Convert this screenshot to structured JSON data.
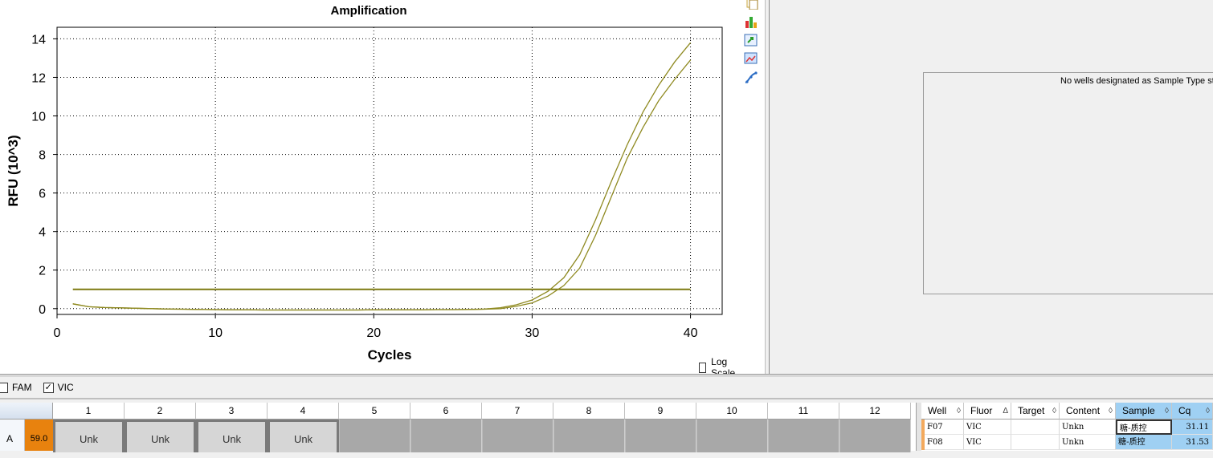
{
  "chart": {
    "title": "Amplification",
    "xlabel": "Cycles",
    "ylabel": "RFU (10^3)",
    "log_scale_label": "Log Scale",
    "log_scale_checked": false
  },
  "chart_data": {
    "type": "line",
    "title": "Amplification",
    "xlabel": "Cycles",
    "ylabel": "RFU (10^3)",
    "xlim": [
      0,
      42
    ],
    "ylim": [
      -0.3,
      14.6
    ],
    "xticks": [
      0,
      10,
      20,
      30,
      40
    ],
    "yticks": [
      0,
      2,
      4,
      6,
      8,
      10,
      12,
      14
    ],
    "grid": true,
    "line_color": "#8f8a21",
    "threshold": 1.0,
    "threshold_x": [
      1,
      40
    ],
    "x": [
      1,
      2,
      3,
      4,
      5,
      6,
      7,
      8,
      9,
      10,
      11,
      12,
      13,
      14,
      15,
      16,
      17,
      18,
      19,
      20,
      21,
      22,
      23,
      24,
      25,
      26,
      27,
      28,
      29,
      30,
      31,
      32,
      33,
      34,
      35,
      36,
      37,
      38,
      39,
      40
    ],
    "series": [
      {
        "values": [
          0.25,
          0.1,
          0.06,
          0.04,
          0.02,
          0.0,
          -0.02,
          -0.03,
          -0.04,
          -0.05,
          -0.06,
          -0.06,
          -0.07,
          -0.07,
          -0.07,
          -0.07,
          -0.07,
          -0.07,
          -0.07,
          -0.06,
          -0.06,
          -0.06,
          -0.06,
          -0.05,
          -0.05,
          -0.04,
          -0.02,
          0.05,
          0.2,
          0.45,
          0.9,
          1.6,
          2.8,
          4.6,
          6.6,
          8.5,
          10.2,
          11.6,
          12.8,
          13.8
        ]
      },
      {
        "values": [
          0.25,
          0.1,
          0.06,
          0.04,
          0.02,
          0.0,
          -0.02,
          -0.03,
          -0.04,
          -0.05,
          -0.06,
          -0.06,
          -0.07,
          -0.07,
          -0.07,
          -0.07,
          -0.07,
          -0.07,
          -0.07,
          -0.06,
          -0.06,
          -0.06,
          -0.06,
          -0.05,
          -0.05,
          -0.04,
          -0.03,
          0.0,
          0.12,
          0.3,
          0.65,
          1.2,
          2.1,
          3.8,
          5.8,
          7.8,
          9.4,
          10.8,
          11.9,
          12.9
        ]
      }
    ]
  },
  "tools": [
    "copy-icon",
    "bar-chart-icon",
    "export-icon",
    "image-icon",
    "curve-icon"
  ],
  "standard_curve": {
    "message": "No wells designated as Sample Type sta"
  },
  "fluors": [
    {
      "label": "FAM",
      "checked": false
    },
    {
      "label": "VIC",
      "checked": true
    }
  ],
  "plate": {
    "columns": [
      "1",
      "2",
      "3",
      "4",
      "5",
      "6",
      "7",
      "8",
      "9",
      "10",
      "11",
      "12"
    ],
    "row_label": "A",
    "temperature": "59.0",
    "wells": [
      "Unk",
      "Unk",
      "Unk",
      "Unk",
      "",
      "",
      "",
      "",
      "",
      "",
      "",
      ""
    ]
  },
  "well_table": {
    "headers": [
      {
        "label": "Well",
        "sort": "◊"
      },
      {
        "label": "Fluor",
        "sort": "Δ"
      },
      {
        "label": "Target",
        "sort": "◊"
      },
      {
        "label": "Content",
        "sort": "◊"
      },
      {
        "label": "Sample",
        "sort": "◊"
      },
      {
        "label": "Cq",
        "sort": "◊"
      }
    ],
    "rows": [
      {
        "well": "F07",
        "fluor": "VIC",
        "target": "",
        "content": "Unkn",
        "sample": "糖-质控",
        "cq": "31.11"
      },
      {
        "well": "F08",
        "fluor": "VIC",
        "target": "",
        "content": "Unkn",
        "sample": "糖-质控",
        "cq": "31.53"
      }
    ]
  }
}
